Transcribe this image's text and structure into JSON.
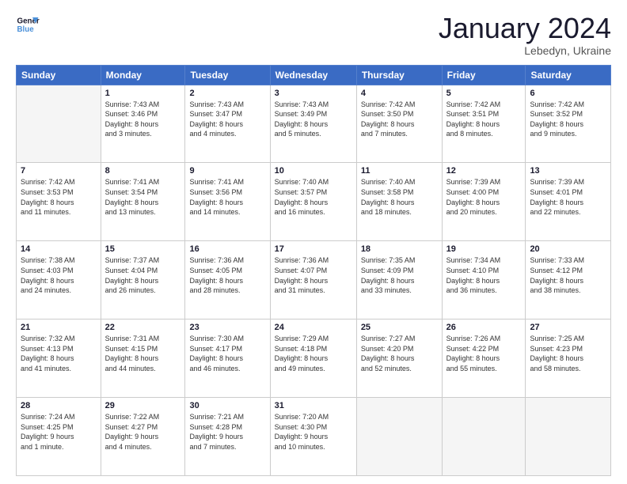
{
  "header": {
    "logo_general": "General",
    "logo_blue": "Blue",
    "main_title": "January 2024",
    "subtitle": "Lebedyn, Ukraine"
  },
  "weekdays": [
    "Sunday",
    "Monday",
    "Tuesday",
    "Wednesday",
    "Thursday",
    "Friday",
    "Saturday"
  ],
  "weeks": [
    [
      {
        "day": "",
        "info": ""
      },
      {
        "day": "1",
        "info": "Sunrise: 7:43 AM\nSunset: 3:46 PM\nDaylight: 8 hours\nand 3 minutes."
      },
      {
        "day": "2",
        "info": "Sunrise: 7:43 AM\nSunset: 3:47 PM\nDaylight: 8 hours\nand 4 minutes."
      },
      {
        "day": "3",
        "info": "Sunrise: 7:43 AM\nSunset: 3:49 PM\nDaylight: 8 hours\nand 5 minutes."
      },
      {
        "day": "4",
        "info": "Sunrise: 7:42 AM\nSunset: 3:50 PM\nDaylight: 8 hours\nand 7 minutes."
      },
      {
        "day": "5",
        "info": "Sunrise: 7:42 AM\nSunset: 3:51 PM\nDaylight: 8 hours\nand 8 minutes."
      },
      {
        "day": "6",
        "info": "Sunrise: 7:42 AM\nSunset: 3:52 PM\nDaylight: 8 hours\nand 9 minutes."
      }
    ],
    [
      {
        "day": "7",
        "info": "Sunrise: 7:42 AM\nSunset: 3:53 PM\nDaylight: 8 hours\nand 11 minutes."
      },
      {
        "day": "8",
        "info": "Sunrise: 7:41 AM\nSunset: 3:54 PM\nDaylight: 8 hours\nand 13 minutes."
      },
      {
        "day": "9",
        "info": "Sunrise: 7:41 AM\nSunset: 3:56 PM\nDaylight: 8 hours\nand 14 minutes."
      },
      {
        "day": "10",
        "info": "Sunrise: 7:40 AM\nSunset: 3:57 PM\nDaylight: 8 hours\nand 16 minutes."
      },
      {
        "day": "11",
        "info": "Sunrise: 7:40 AM\nSunset: 3:58 PM\nDaylight: 8 hours\nand 18 minutes."
      },
      {
        "day": "12",
        "info": "Sunrise: 7:39 AM\nSunset: 4:00 PM\nDaylight: 8 hours\nand 20 minutes."
      },
      {
        "day": "13",
        "info": "Sunrise: 7:39 AM\nSunset: 4:01 PM\nDaylight: 8 hours\nand 22 minutes."
      }
    ],
    [
      {
        "day": "14",
        "info": "Sunrise: 7:38 AM\nSunset: 4:03 PM\nDaylight: 8 hours\nand 24 minutes."
      },
      {
        "day": "15",
        "info": "Sunrise: 7:37 AM\nSunset: 4:04 PM\nDaylight: 8 hours\nand 26 minutes."
      },
      {
        "day": "16",
        "info": "Sunrise: 7:36 AM\nSunset: 4:05 PM\nDaylight: 8 hours\nand 28 minutes."
      },
      {
        "day": "17",
        "info": "Sunrise: 7:36 AM\nSunset: 4:07 PM\nDaylight: 8 hours\nand 31 minutes."
      },
      {
        "day": "18",
        "info": "Sunrise: 7:35 AM\nSunset: 4:09 PM\nDaylight: 8 hours\nand 33 minutes."
      },
      {
        "day": "19",
        "info": "Sunrise: 7:34 AM\nSunset: 4:10 PM\nDaylight: 8 hours\nand 36 minutes."
      },
      {
        "day": "20",
        "info": "Sunrise: 7:33 AM\nSunset: 4:12 PM\nDaylight: 8 hours\nand 38 minutes."
      }
    ],
    [
      {
        "day": "21",
        "info": "Sunrise: 7:32 AM\nSunset: 4:13 PM\nDaylight: 8 hours\nand 41 minutes."
      },
      {
        "day": "22",
        "info": "Sunrise: 7:31 AM\nSunset: 4:15 PM\nDaylight: 8 hours\nand 44 minutes."
      },
      {
        "day": "23",
        "info": "Sunrise: 7:30 AM\nSunset: 4:17 PM\nDaylight: 8 hours\nand 46 minutes."
      },
      {
        "day": "24",
        "info": "Sunrise: 7:29 AM\nSunset: 4:18 PM\nDaylight: 8 hours\nand 49 minutes."
      },
      {
        "day": "25",
        "info": "Sunrise: 7:27 AM\nSunset: 4:20 PM\nDaylight: 8 hours\nand 52 minutes."
      },
      {
        "day": "26",
        "info": "Sunrise: 7:26 AM\nSunset: 4:22 PM\nDaylight: 8 hours\nand 55 minutes."
      },
      {
        "day": "27",
        "info": "Sunrise: 7:25 AM\nSunset: 4:23 PM\nDaylight: 8 hours\nand 58 minutes."
      }
    ],
    [
      {
        "day": "28",
        "info": "Sunrise: 7:24 AM\nSunset: 4:25 PM\nDaylight: 9 hours\nand 1 minute."
      },
      {
        "day": "29",
        "info": "Sunrise: 7:22 AM\nSunset: 4:27 PM\nDaylight: 9 hours\nand 4 minutes."
      },
      {
        "day": "30",
        "info": "Sunrise: 7:21 AM\nSunset: 4:28 PM\nDaylight: 9 hours\nand 7 minutes."
      },
      {
        "day": "31",
        "info": "Sunrise: 7:20 AM\nSunset: 4:30 PM\nDaylight: 9 hours\nand 10 minutes."
      },
      {
        "day": "",
        "info": ""
      },
      {
        "day": "",
        "info": ""
      },
      {
        "day": "",
        "info": ""
      }
    ]
  ]
}
